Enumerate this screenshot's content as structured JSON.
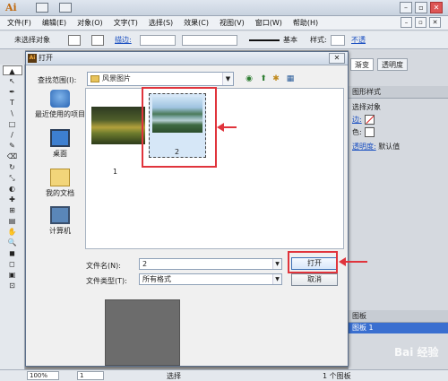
{
  "app": {
    "logo": "Ai"
  },
  "window": {
    "minimize": "–",
    "restore": "▫",
    "close": "✕"
  },
  "menu": [
    "文件(F)",
    "编辑(E)",
    "对象(O)",
    "文字(T)",
    "选择(S)",
    "效果(C)",
    "视图(V)",
    "窗口(W)",
    "帮助(H)"
  ],
  "control": {
    "selection": "未选择对象",
    "stroke_label": "描边:",
    "stroke_style": "基本",
    "style_label": "样式:",
    "opacity_link": "不透"
  },
  "tools": [
    "▲",
    "↖",
    "✒",
    "T",
    "\\",
    "□",
    "/",
    "✎",
    "⌫",
    "↻",
    "⤡",
    "◐",
    "✚",
    "⊞",
    "▤",
    "✋",
    "🔍",
    "◼",
    "◻",
    "▣",
    "⊡"
  ],
  "right_panel": {
    "tabs": [
      "渐变",
      "透明度"
    ],
    "panel_title": "图形样式",
    "selection": "选择对象",
    "stroke_row": "边:",
    "fill_row": "色:",
    "opacity_row": "透明度:",
    "opacity_value": "默认值",
    "layers_title": "图板",
    "layer_name": "图板 1"
  },
  "status": {
    "zoom": "100%",
    "page": "1",
    "tool": "选择",
    "info": "1 个图板"
  },
  "dialog": {
    "title": "打开",
    "ai_badge": "Ai",
    "close": "✕",
    "look_in_label": "查找范围(I):",
    "look_in_value": "风景图片",
    "nav_icons": [
      "back-icon",
      "up-folder-icon",
      "new-folder-icon",
      "views-menu-icon"
    ],
    "places": [
      {
        "label": "最近使用的项目",
        "icon": "recent-icon"
      },
      {
        "label": "桌面",
        "icon": "desktop-icon"
      },
      {
        "label": "我的文档",
        "icon": "documents-icon"
      },
      {
        "label": "计算机",
        "icon": "computer-icon"
      }
    ],
    "files": [
      {
        "name": "1",
        "selected": false
      },
      {
        "name": "2",
        "selected": true
      }
    ],
    "filename_label": "文件名(N):",
    "filename_value": "2",
    "filetype_label": "文件类型(T):",
    "filetype_value": "所有格式",
    "open_button": "打开",
    "cancel_button": "取消"
  },
  "watermark": "Bai 经验",
  "colors": {
    "annotation_red": "#e0343c",
    "selection_blue": "#3a6fd0"
  }
}
